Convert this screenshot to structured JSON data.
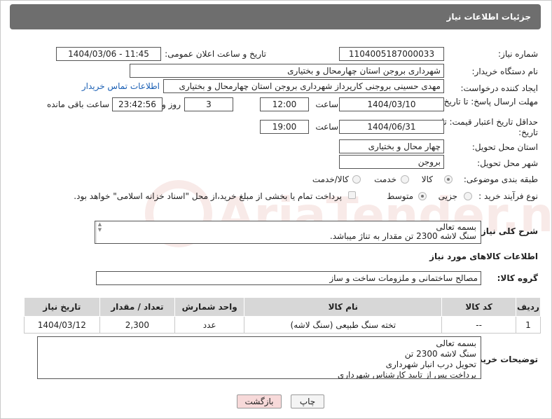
{
  "header": {
    "title": "جزئیات اطلاعات نیاز"
  },
  "fields": {
    "need_number_label": "شماره نیاز:",
    "need_number": "1104005187000033",
    "announce_label": "تاریخ و ساعت اعلان عمومی:",
    "announce_value": "1404/03/06 - 11:45",
    "buyer_org_label": "نام دستگاه خریدار:",
    "buyer_org": "شهرداری بروجن استان چهارمحال و بختیاری",
    "creator_label": "ایجاد کننده درخواست:",
    "creator": "مهدی حسینی بروجنی کارپرداز شهرداری بروجن استان چهارمحال و بختیاری",
    "contact_link": "اطلاعات تماس خریدار",
    "deadline_label": "مهلت ارسال پاسخ: تا تاریخ:",
    "deadline_date": "1404/03/10",
    "time_label": "ساعت",
    "deadline_time": "12:00",
    "deadline_days": "3",
    "days_label": "روز و",
    "deadline_remaining": "23:42:56",
    "remaining_label": "ساعت باقی مانده",
    "validity_label": "حداقل تاریخ اعتبار قیمت: تا تاریخ:",
    "validity_date": "1404/06/31",
    "validity_time": "19:00",
    "delivery_province_label": "استان محل تحویل:",
    "delivery_province": "چهار محال و بختیاری",
    "delivery_city_label": "شهر محل تحویل:",
    "delivery_city": "بروجن",
    "category_label": "طبقه بندی موضوعی:",
    "category_options": [
      "کالا",
      "خدمت",
      "کالا/خدمت"
    ],
    "process_label": "نوع فرآیند خرید :",
    "process_options": [
      "جزیی",
      "متوسط"
    ],
    "payment_note": "پرداخت تمام یا بخشی از مبلغ خرید،از محل \"اسناد خزانه اسلامی\" خواهد بود."
  },
  "description": {
    "label": "شرح کلی نیاز:",
    "lines": [
      "بسمه تعالی",
      "سنگ لاشه 2300 تن مقدار به تناژ میباشد."
    ]
  },
  "goods_section": {
    "title": "اطلاعات کالاهای مورد نیاز",
    "group_label": "گروه کالا:",
    "group_value": "مصالح ساختمانی و ملزومات ساخت و ساز"
  },
  "table": {
    "headers": [
      "ردیف",
      "کد کالا",
      "نام کالا",
      "واحد شمارش",
      "تعداد / مقدار",
      "تاریخ نیاز"
    ],
    "rows": [
      [
        "1",
        "--",
        "تخته سنگ طبیعی (سنگ لاشه)",
        "عدد",
        "2,300",
        "1404/03/12"
      ]
    ]
  },
  "buyer_notes": {
    "label": "توضیحات خریدار:",
    "lines": [
      "بسمه تعالی",
      "سنگ لاشه 2300 تن",
      "تحویل درب انبار شهرداری",
      "پرداخت پس از تایید کارشناس شهرداری"
    ]
  },
  "buttons": {
    "print": "چاپ",
    "back": "بازگشت"
  },
  "watermark": {
    "text": "AriaTender.neT"
  },
  "colors": {
    "header_bg": "#6e6e6e",
    "table_header_bg": "#d7d7d7",
    "link": "#1a5fb4",
    "back_button_bg": "#f7d9d9"
  }
}
